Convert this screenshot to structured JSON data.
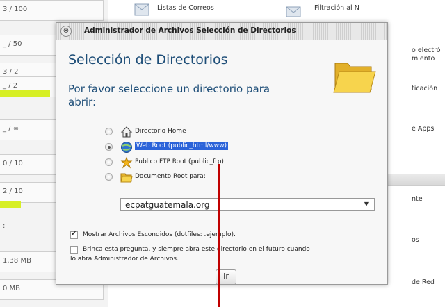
{
  "background": {
    "stats": [
      "3 / 100",
      "_ / 50",
      "3 / 2",
      "_ / 2",
      "_ / ∞",
      "0 / 10",
      "2 / 10",
      ":",
      "1.38 MB",
      "0 MB"
    ],
    "main_items": [
      "Listas de Correos",
      "Filtración al N",
      "o electró",
      "miento",
      "ticación",
      "e Apps",
      "nte",
      "os",
      "de Red"
    ]
  },
  "dialog": {
    "title": "Administrador de Archivos Selección de Directorios",
    "close_symbol": "⊗",
    "heading": "Selección de Directorios",
    "prompt": "Por favor seleccione un directorio para abrir:",
    "options": [
      {
        "label": "Directorio Home",
        "icon": "home-icon",
        "checked": false,
        "selected": false
      },
      {
        "label": "Web Root (public_html/www)",
        "icon": "globe-icon",
        "checked": true,
        "selected": true
      },
      {
        "label": "Publico FTP Root (public_ftp)",
        "icon": "ftp-icon",
        "checked": false,
        "selected": false
      },
      {
        "label": "Documento Root para:",
        "icon": "folder-icon",
        "checked": false,
        "selected": false
      }
    ],
    "docroot_value": "ecpatguatemala.org",
    "docroot_arrow": "▼",
    "show_hidden_label": "Mostrar Archivos Escondidos (dotfiles: .ejemplo).",
    "show_hidden_checked": true,
    "skip_label": "Brinca esta pregunta, y siempre abra este directorio en el futuro cuando",
    "skip_label_cont": "lo abra Administrador de Archivos.",
    "skip_checked": false,
    "go_button": "Ir"
  },
  "colors": {
    "heading": "#1e4e78",
    "selection": "#2b63d9",
    "usage_bar": "#d7ef24",
    "cursor": "#c00000"
  }
}
